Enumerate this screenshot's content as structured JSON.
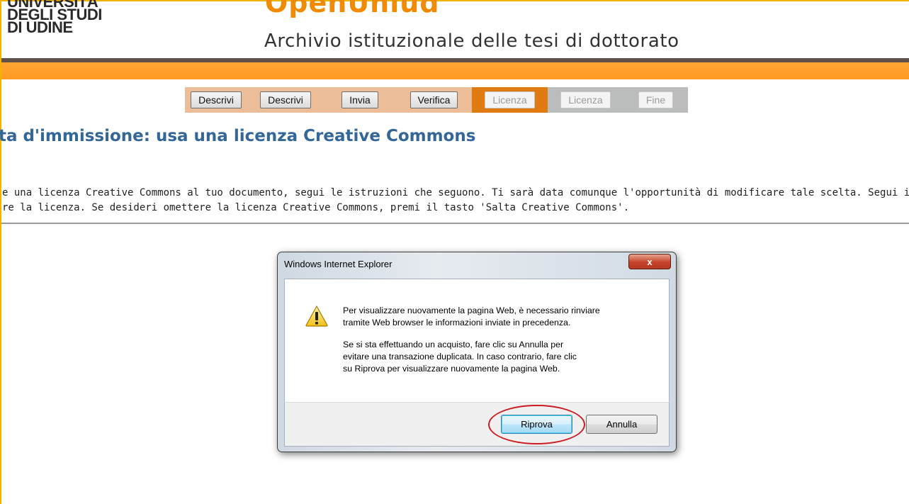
{
  "header": {
    "university_lines": [
      "UNIVERSITÀ",
      "DEGLI STUDI",
      "DI UDINE"
    ],
    "brand": "OpenUniud",
    "site_title": "Archivio istituzionale delle tesi di dottorato"
  },
  "steps": [
    {
      "label": "Descrivi",
      "state": "done"
    },
    {
      "label": "Descrivi",
      "state": "done"
    },
    {
      "label": "Invia",
      "state": "done"
    },
    {
      "label": "Verifica",
      "state": "done"
    },
    {
      "label": "Licenza",
      "state": "current"
    },
    {
      "label": "Licenza",
      "state": "future"
    },
    {
      "label": "Fine",
      "state": "future"
    }
  ],
  "page": {
    "heading": "ta d'immissione: usa una licenza Creative Commons",
    "intro_line1": "e una licenza Creative Commons al tuo documento, segui le istruzioni che seguono. Ti sarà data comunque l'opportunità di modificare tale scelta. Segui il l",
    "intro_line2": "re la licenza. Se desideri omettere la licenza Creative Commons, premi il tasto 'Salta Creative Commons'."
  },
  "dialog": {
    "title": "Windows Internet Explorer",
    "close_label": "x",
    "icon": "warning-icon",
    "message1_line1": "Per visualizzare nuovamente la pagina Web, è necessario rinviare",
    "message1_line2": "tramite Web browser le informazioni inviate in precedenza.",
    "message2_line1": "Se si sta effettuando un acquisto, fare clic su Annulla per",
    "message2_line2": "evitare una transazione duplicata. In caso contrario, fare clic",
    "message2_line3": "su Riprova per visualizzare nuovamente la pagina Web.",
    "retry_label": "Riprova",
    "cancel_label": "Annulla"
  },
  "colors": {
    "brand_orange": "#f08a00",
    "heading_blue": "#336699",
    "annotation_red": "#cc1b22"
  }
}
